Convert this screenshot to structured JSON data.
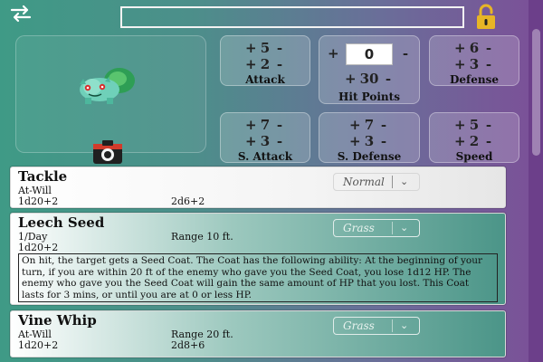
{
  "header": {
    "nickname_value": "",
    "lock_state": "locked"
  },
  "icons": {
    "swap": "swap-arrows-icon",
    "lock": "padlock-icon",
    "camera": "camera-icon"
  },
  "pokemon": {
    "sprite": "bulbasaur-sprite"
  },
  "stats": {
    "attack": {
      "add": "5",
      "base": "2",
      "label": "Attack"
    },
    "hit_points": {
      "input": "0",
      "total": "30",
      "label": "Hit Points"
    },
    "defense": {
      "add": "6",
      "base": "3",
      "label": "Defense"
    },
    "sp_attack": {
      "add": "7",
      "base": "3",
      "label": "S. Attack"
    },
    "sp_defense": {
      "add": "7",
      "base": "3",
      "label": "S. Defense"
    },
    "speed": {
      "add": "5",
      "base": "2",
      "label": "Speed"
    }
  },
  "moves": [
    {
      "name": "Tackle",
      "frequency": "At-Will",
      "range": "",
      "to_hit": "1d20+2",
      "damage": "2d6+2",
      "type": "Normal",
      "description": ""
    },
    {
      "name": "Leech Seed",
      "frequency": "1/Day",
      "range": "Range 10 ft.",
      "to_hit": "1d20+2",
      "damage": "",
      "type": "Grass",
      "description": "On hit, the target gets a Seed Coat. The Coat has the following ability: At the beginning of your turn, if you are within 20 ft of the enemy who gave you the Seed Coat, you lose 1d12 HP. The enemy who gave you the Seed Coat will gain the same amount of HP that you lost. This Coat lasts for 3 mins, or until you are at 0 or less HP."
    },
    {
      "name": "Vine Whip",
      "frequency": "At-Will",
      "range": "Range 20 ft.",
      "to_hit": "1d20+2",
      "damage": "2d8+6",
      "type": "Grass",
      "description": ""
    }
  ],
  "colors": {
    "accent_gold": "#e7b526",
    "grass_teal": "#4b9588",
    "scroll_purple": "#6c3f8a"
  }
}
